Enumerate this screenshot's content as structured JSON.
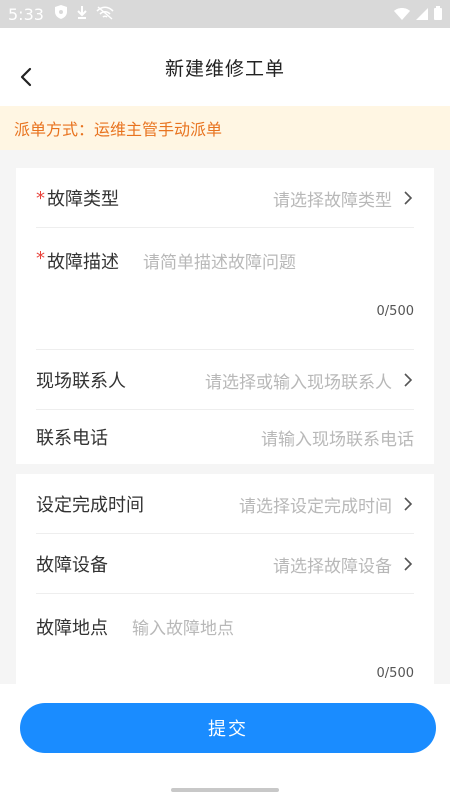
{
  "status_bar": {
    "time": "5:33"
  },
  "header": {
    "title": "新建维修工单"
  },
  "dispatch": {
    "text": "派单方式：运维主管手动派单"
  },
  "form_group_1": {
    "fault_type": {
      "required_mark": "*",
      "label": "故障类型",
      "placeholder": "请选择故障类型"
    },
    "fault_desc": {
      "required_mark": "*",
      "label": "故障描述",
      "placeholder": "请简单描述故障问题",
      "counter": "0/500"
    },
    "contact": {
      "label": "现场联系人",
      "placeholder": "请选择或输入现场联系人"
    },
    "phone": {
      "label": "联系电话",
      "placeholder": "请输入现场联系电话"
    }
  },
  "form_group_2": {
    "finish_time": {
      "label": "设定完成时间",
      "placeholder": "请选择设定完成时间"
    },
    "equipment": {
      "label": "故障设备",
      "placeholder": "请选择故障设备"
    },
    "location": {
      "label": "故障地点",
      "placeholder": "输入故障地点",
      "counter": "0/500"
    }
  },
  "footer": {
    "submit_label": "提交"
  },
  "colors": {
    "accent": "#1a8cff",
    "warning_text": "#e8731f",
    "warning_bg": "#fff6e3",
    "required": "#e8413a"
  }
}
